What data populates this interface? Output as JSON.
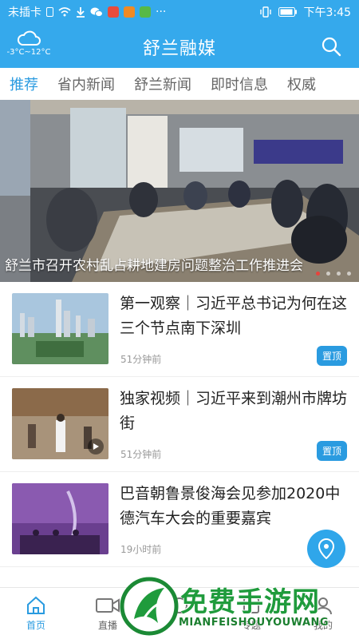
{
  "status_bar": {
    "carrier": "未插卡",
    "time": "下午3:45",
    "more": "···"
  },
  "header": {
    "weather_temp": "-3°C~12°C",
    "title": "舒兰融媒"
  },
  "tabs": [
    {
      "label": "推荐",
      "active": true
    },
    {
      "label": "省内新闻",
      "active": false
    },
    {
      "label": "舒兰新闻",
      "active": false
    },
    {
      "label": "即时信息",
      "active": false
    },
    {
      "label": "权威",
      "active": false
    }
  ],
  "banner": {
    "caption": "舒兰市召开农村乱占耕地建房问题整治工作推进会",
    "dots": 4,
    "active_dot": 0
  },
  "news": [
    {
      "title": "第一观察｜习近平总书记为何在这三个节点南下深圳",
      "time": "51分钟前",
      "badge": "置顶"
    },
    {
      "title": "独家视频｜习近平来到潮州市牌坊街",
      "time": "51分钟前",
      "badge": "置顶"
    },
    {
      "title": "巴音朝鲁景俊海会见参加2020中德汽车大会的重要嘉宾",
      "time": "19小时前",
      "badge": ""
    }
  ],
  "bottom_nav": [
    {
      "label": "首页",
      "icon": "home-icon",
      "active": true
    },
    {
      "label": "直播",
      "icon": "video-icon",
      "active": false
    },
    {
      "label": "",
      "icon": "center-icon",
      "active": false
    },
    {
      "label": "专题",
      "icon": "topic-icon",
      "active": false
    },
    {
      "label": "我的",
      "icon": "user-icon",
      "active": false
    }
  ],
  "watermark": {
    "text": "免费手游网",
    "sub": "MIANFEISHOUYOUWANG"
  },
  "colors": {
    "brand": "#35a9ec",
    "accent": "#2a9be0"
  }
}
